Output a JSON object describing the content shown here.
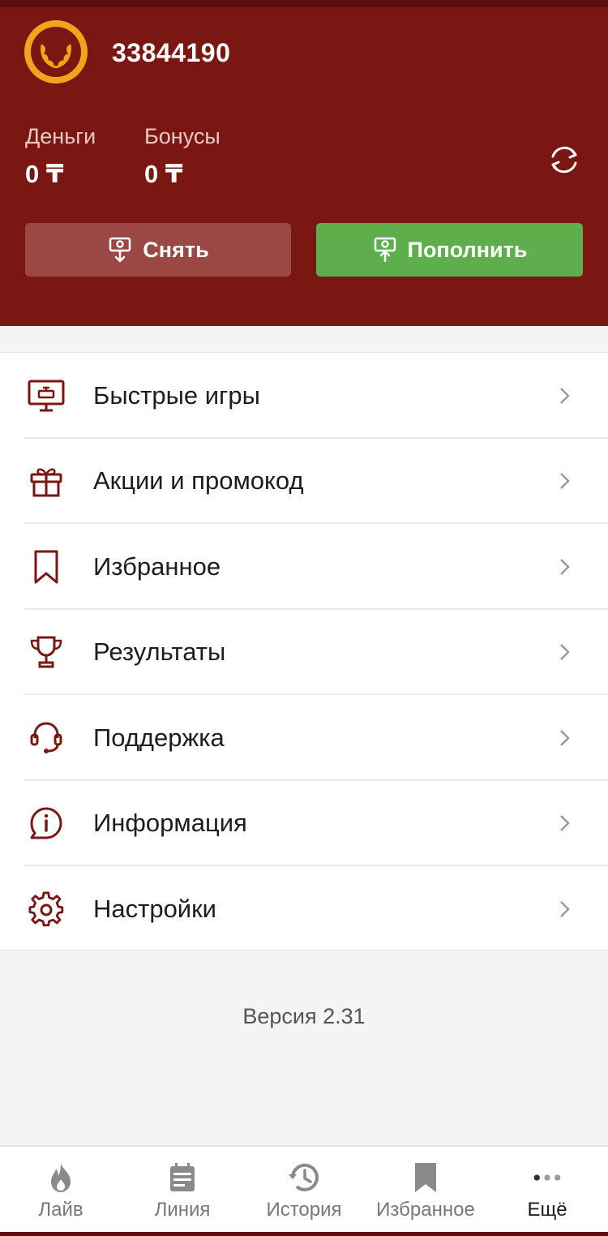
{
  "account": {
    "id": "33844190"
  },
  "balances": {
    "money_label": "Деньги",
    "money_value": "0 ₸",
    "bonus_label": "Бонусы",
    "bonus_value": "0 ₸"
  },
  "actions": {
    "withdraw_label": "Снять",
    "deposit_label": "Пополнить"
  },
  "menu": {
    "items": [
      {
        "label": "Быстрые игры",
        "icon": "monitor-game-icon"
      },
      {
        "label": "Акции и промокод",
        "icon": "gift-icon"
      },
      {
        "label": "Избранное",
        "icon": "bookmark-icon"
      },
      {
        "label": "Результаты",
        "icon": "trophy-icon"
      },
      {
        "label": "Поддержка",
        "icon": "headset-icon"
      },
      {
        "label": "Информация",
        "icon": "info-icon"
      },
      {
        "label": "Настройки",
        "icon": "gear-icon"
      }
    ]
  },
  "version": "Версия 2.31",
  "tabs": [
    {
      "label": "Лайв",
      "icon": "flame-icon"
    },
    {
      "label": "Линия",
      "icon": "calendar-icon"
    },
    {
      "label": "История",
      "icon": "history-icon"
    },
    {
      "label": "Избранное",
      "icon": "bookmark-icon"
    },
    {
      "label": "Ещё",
      "icon": "more-dots-icon",
      "active": true
    }
  ],
  "colors": {
    "header_bg": "#7a1712",
    "accent": "#7a1712",
    "deposit_green": "#5fae4d",
    "withdraw_bg": "#9b4845",
    "avatar_gold": "#f2a41c"
  }
}
